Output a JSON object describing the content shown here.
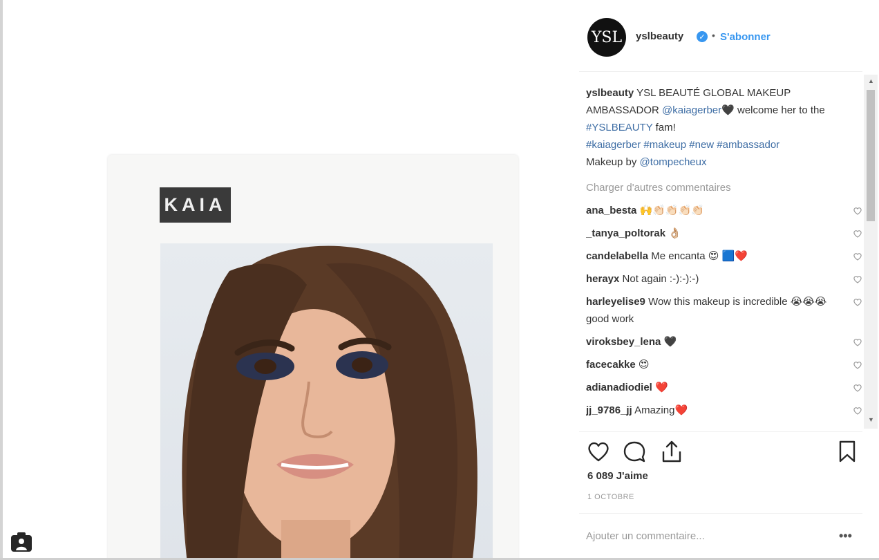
{
  "post": {
    "brand_logo_text": "KAIA"
  },
  "header": {
    "avatar_text": "YSL",
    "username": "yslbeauty",
    "verified_mark": "✓",
    "separator": "•",
    "follow_label": "S'abonner"
  },
  "caption": {
    "user": "yslbeauty",
    "text1": "YSL BEAUTÉ GLOBAL MAKEUP AMBASSADOR",
    "mention1": "@kaiagerber",
    "emoji1": "🖤",
    "text2": "welcome her to the",
    "hashtag1": "#YSLBEAUTY",
    "text3": "fam!",
    "hashtags": "#kaiagerber #makeup #new #ambassador",
    "text4": "Makeup by",
    "mention2": "@tompecheux"
  },
  "load_more_label": "Charger d'autres commentaires",
  "comments": [
    {
      "user": "ana_besta",
      "text": "🙌👏🏻👏🏻👏🏻👏🏻"
    },
    {
      "user": "_tanya_poltorak",
      "text": "👌🏼"
    },
    {
      "user": "candelabella",
      "text": "Me encanta 😍 🟦❤️"
    },
    {
      "user": "herayx",
      "text": "Not again :-):-):-)"
    },
    {
      "user": "harleyelise9",
      "text": "Wow this makeup is incredible 😭😭😭 good work"
    },
    {
      "user": "viroksbey_lena",
      "text": "🖤"
    },
    {
      "user": "facecakke",
      "text": "😍"
    },
    {
      "user": "adianadiodiel",
      "text": "❤️"
    },
    {
      "user": "jj_9786_jj",
      "text": "Amazing❤️"
    }
  ],
  "likes_text": "6 089 J'aime",
  "date_text": "1 OCTOBRE",
  "add_comment_placeholder": "Ajouter un commentaire...",
  "more_label": "•••",
  "colors": {
    "link": "#3f6ea5",
    "follow": "#3897f0",
    "muted": "#999999"
  }
}
